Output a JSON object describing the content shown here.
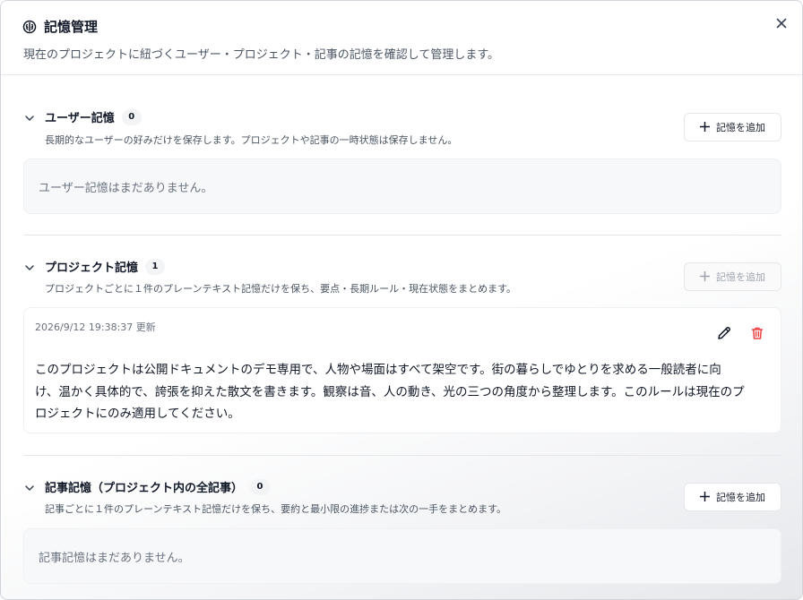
{
  "dialog": {
    "title": "記憶管理",
    "subtitle": "現在のプロジェクトに紐づくユーザー・プロジェクト・記事の記憶を確認して管理します。",
    "icons": {
      "title": "brain-icon",
      "close": "close-icon"
    }
  },
  "sections": {
    "user": {
      "title": "ユーザー記憶",
      "count": "0",
      "description": "長期的なユーザーの好みだけを保存します。プロジェクトや記事の一時状態は保存しません。",
      "add_label": "記憶を追加",
      "empty_text": "ユーザー記憶はまだありません。"
    },
    "project": {
      "title": "プロジェクト記憶",
      "count": "1",
      "description": "プロジェクトごとに１件のプレーンテキスト記憶だけを保ち、要点・長期ルール・現在状態をまとめます。",
      "add_label": "記憶を追加",
      "add_disabled": true,
      "memory": {
        "updated": "2026/9/12 19:38:37 更新",
        "lines": [
          "このプロジェクトは公開ドキュメントのデモ専用で、人物や場面はすべて架空です。街の暮らしでゆとりを求める一般読者に向",
          "け、温かく具体的で、誇張を抑えた散文を書きます。観察は音、人の動き、光の三つの角度から整理します。このルールは現在のプ",
          "ロジェクトにのみ適用してください。"
        ]
      }
    },
    "article": {
      "title": "記事記憶（プロジェクト内の全記事）",
      "count": "0",
      "description": "記事ごとに１件のプレーンテキスト記憶だけを保ち、要約と最小限の進捗または次の一手をまとめます。",
      "add_label": "記憶を追加",
      "empty_text": "記事記憶はまだありません。"
    }
  },
  "colors": {
    "delete": "#ef4444",
    "text": "#111827",
    "muted": "#6b7280",
    "border": "#e5e7eb"
  }
}
